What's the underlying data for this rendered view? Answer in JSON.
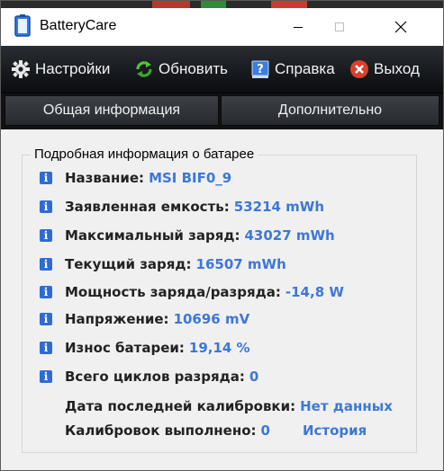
{
  "window": {
    "title": "BatteryCare"
  },
  "toolbar": {
    "settings": "Настройки",
    "refresh": "Обновить",
    "help": "Справка",
    "exit": "Выход"
  },
  "tabs": [
    {
      "label": "Общая информация"
    },
    {
      "label": "Дополнительно"
    }
  ],
  "group": {
    "title": "Подробная информация о батарее",
    "rows": [
      {
        "label": "Название:",
        "value": "MSI BIF0_9"
      },
      {
        "label": "Заявленная емкость:",
        "value": "53214 mWh"
      },
      {
        "label": "Максимальный заряд:",
        "value": "43027 mWh"
      },
      {
        "label": "Текущий заряд:",
        "value": "16507 mWh"
      },
      {
        "label": "Мощность заряда/разряда:",
        "value": "-14,8 W"
      },
      {
        "label": "Напряжение:",
        "value": "10696 mV"
      },
      {
        "label": "Износ батареи:",
        "value": "19,14 %"
      },
      {
        "label": "Всего циклов разряда:",
        "value": "0"
      }
    ],
    "calibration_date_label": "Дата последней калибровки:",
    "calibration_date_value": "Нет данных",
    "calibrations_label": "Калибровок выполнено:",
    "calibrations_value": "0",
    "history_link": "История"
  },
  "colors": {
    "value_blue": "#3d78d8",
    "toolbar_dark": "#171a1e",
    "info_icon": "#2f6bd6"
  },
  "icons": [
    "battery-app-icon",
    "minimize-icon",
    "maximize-icon",
    "close-icon",
    "gear-icon",
    "refresh-icon",
    "help-icon",
    "exit-icon",
    "info-icon"
  ]
}
